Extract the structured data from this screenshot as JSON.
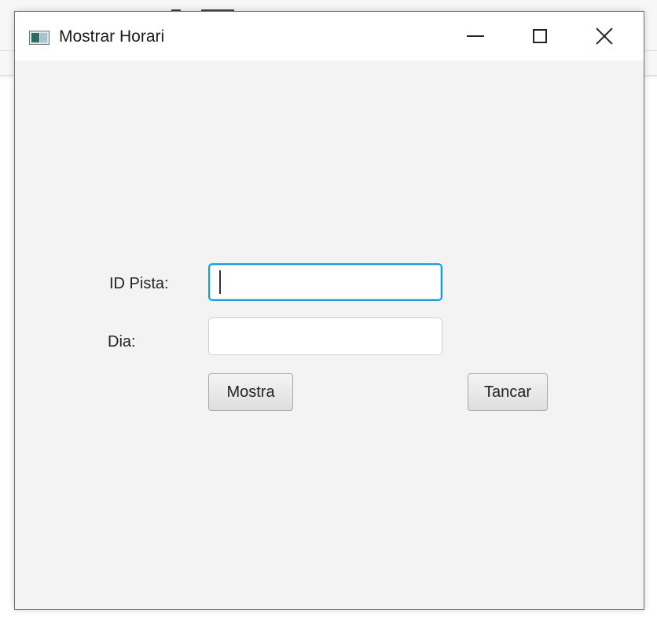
{
  "window": {
    "title": "Mostrar Horari",
    "icon": "app-window-icon",
    "controls": {
      "minimize_icon": "minimize-icon",
      "maximize_icon": "maximize-icon",
      "close_icon": "close-icon"
    }
  },
  "form": {
    "id_pista_label": "ID Pista:",
    "id_pista_value": "",
    "dia_label": "Dia:",
    "dia_value": ""
  },
  "buttons": {
    "mostra_label": "Mostra",
    "tancar_label": "Tancar"
  },
  "colors": {
    "focus_border": "#1a9cd8",
    "window_background": "#f3f3f3",
    "titlebar_background": "#ffffff"
  }
}
